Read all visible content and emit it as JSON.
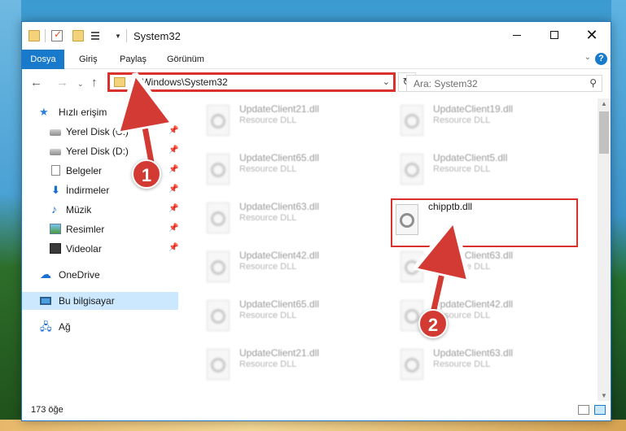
{
  "window": {
    "title": "System32",
    "minimize_glyph": "",
    "close_glyph": "✕"
  },
  "ribbon": {
    "tabs": [
      "Dosya",
      "Giriş",
      "Paylaş",
      "Görünüm"
    ],
    "help_label": "?"
  },
  "navigation": {
    "address_path": "C:\\Windows\\System32",
    "search_placeholder": "Ara: System32"
  },
  "sidebar": {
    "quick_access_label": "Hızlı erişim",
    "items": [
      {
        "label": "Yerel Disk (C:)",
        "icon": "drive-icon",
        "pinned": true
      },
      {
        "label": "Yerel Disk (D:)",
        "icon": "drive-icon",
        "pinned": true
      },
      {
        "label": "Belgeler",
        "icon": "documents-icon",
        "pinned": true
      },
      {
        "label": "İndirmeler",
        "icon": "download-icon",
        "pinned": true
      },
      {
        "label": "Müzik",
        "icon": "music-icon",
        "pinned": true
      },
      {
        "label": "Resimler",
        "icon": "pictures-icon",
        "pinned": true
      },
      {
        "label": "Videolar",
        "icon": "videos-icon",
        "pinned": true
      }
    ],
    "onedrive_label": "OneDrive",
    "this_pc_label": "Bu bilgisayar",
    "network_label": "Ağ"
  },
  "files": [
    {
      "name": "UpdateClient21.dll",
      "type": "Resource DLL"
    },
    {
      "name": "UpdateClient19.dll",
      "type": "Resource DLL"
    },
    {
      "name": "UpdateClient65.dll",
      "type": "Resource DLL"
    },
    {
      "name": "UpdateClient5.dll",
      "type": "Resource DLL"
    },
    {
      "name": "UpdateClient63.dll",
      "type": "Resource DLL"
    },
    {
      "name": "chipptb.dll",
      "type": ""
    },
    {
      "name": "UpdateClient42.dll",
      "type": "Resource DLL"
    },
    {
      "name": "UpdateClient63.dll",
      "type": "Resource DLL"
    },
    {
      "name": "UpdateClient65.dll",
      "type": "Resource DLL"
    },
    {
      "name": "UpdateClient42.dll",
      "type": "Resource DLL"
    },
    {
      "name": "UpdateClient21.dll",
      "type": "Resource DLL"
    },
    {
      "name": "UpdateClient63.dll",
      "type": "Resource DLL"
    }
  ],
  "status": {
    "item_count": "173 öğe"
  },
  "annotations": {
    "step1": "1",
    "step2": "2",
    "highlight_color": "#d9312b"
  }
}
